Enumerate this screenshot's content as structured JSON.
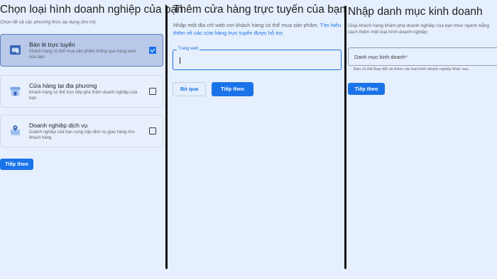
{
  "step1": {
    "title": "Chọn loại hình doanh nghiệp của bạn",
    "subtitle": "Chọn tất cả các phương thức áp dụng cho mỳ",
    "options": [
      {
        "label": "Bán lẻ trực tuyến",
        "description": "Khách hàng có thể mua sản phẩm thông qua trang web của bạn",
        "checked": true,
        "icon": "online-store-icon"
      },
      {
        "label": "Cửa hàng tại địa phương",
        "description": "Khách hàng có thể trực tiếp ghé thăm doanh nghiệp của bạn",
        "checked": false,
        "icon": "storefront-icon"
      },
      {
        "label": "Doanh nghiệp dịch vụ",
        "description": "Doanh nghiệp của bạn cung cấp dịch vụ giao hàng cho khách hàng",
        "checked": false,
        "icon": "service-area-icon"
      }
    ],
    "next_label": "Tiếp theo"
  },
  "step2": {
    "title": "Thêm cửa hàng trực tuyến của bạn",
    "description": "Nhập một địa chỉ web nơi khách hàng có thể mua sản phẩm. ",
    "link_text": "Tìm hiểu thêm về các cửa hàng trực tuyến được hỗ trợ.",
    "field_label": "Trang web",
    "field_value": "",
    "skip_label": "Bỏ qua",
    "next_label": "Tiếp theo"
  },
  "step3": {
    "title": "Nhập danh mục kinh doanh",
    "description": "Giúp khách hàng khám phá doanh nghiệp của bạn theo ngành bằng cách thêm một loại hình doanh nghiệp",
    "field_label": "Danh mục kinh doanh*",
    "helper": "Bạn có thể thay đổi và thêm các loại hình doanh nghiệp khác sau",
    "next_label": "Tiếp theo"
  },
  "colors": {
    "background": "#e6effd",
    "primary": "#1a73e8",
    "selected": "#b9c9ea",
    "divider": "#111111"
  }
}
